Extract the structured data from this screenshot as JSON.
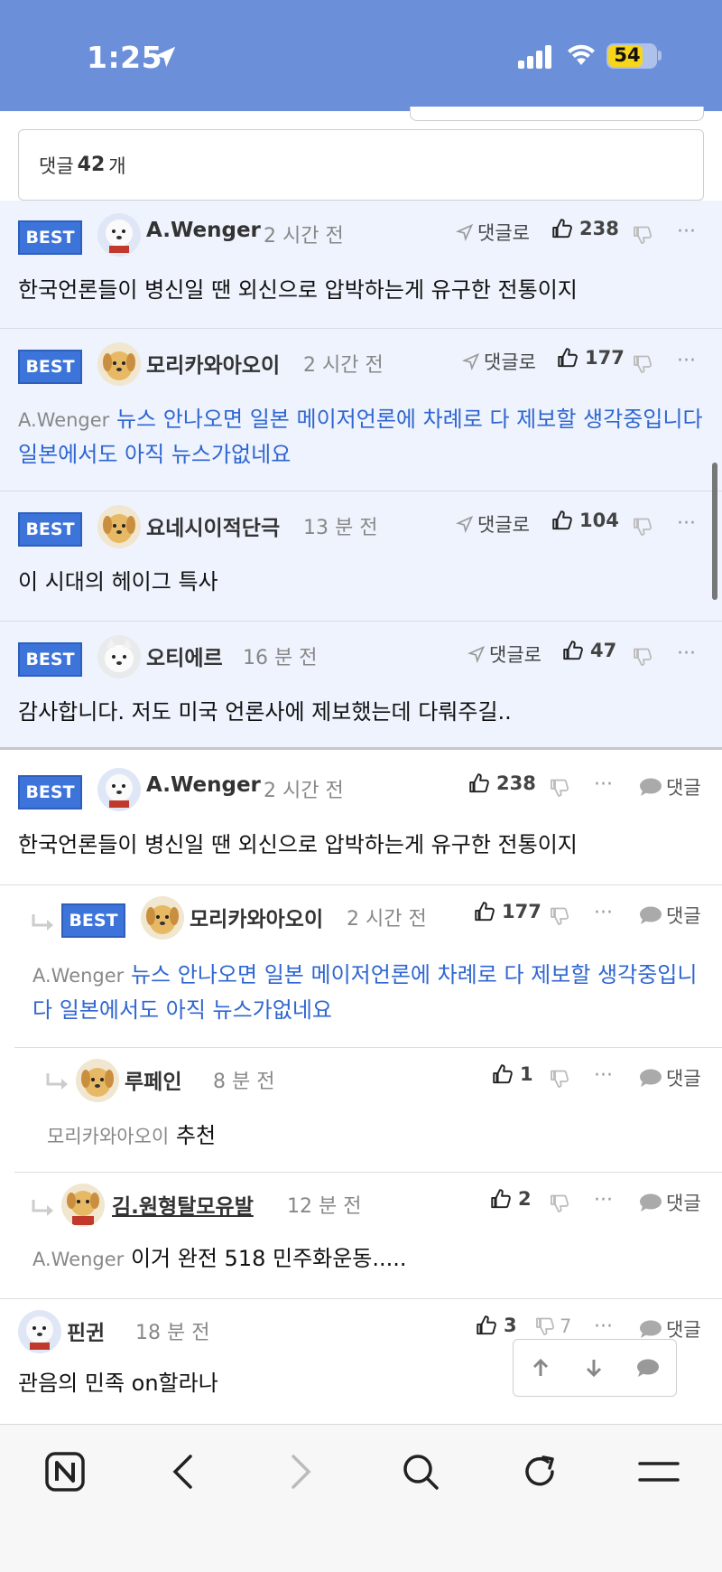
{
  "status_bar": {
    "time": "1:25",
    "battery": "54"
  },
  "comment_count": {
    "prefix": "댓글",
    "count": "42",
    "suffix": "개"
  },
  "labels": {
    "best": "BEST",
    "reply_to": "댓글로",
    "reply": "댓글"
  },
  "best_comments": [
    {
      "nick": "A.Wenger",
      "time": "2 시간 전",
      "likes": "238",
      "text": "한국언론들이 병신일 땐 외신으로 압박하는게 유구한 전통이지"
    },
    {
      "nick": "모리카와아오이",
      "time": "2 시간 전",
      "likes": "177",
      "mention": "A.Wenger",
      "text": "뉴스 안나오면 일본 메이저언론에 차례로 다 제보할 생각중입니다 일본에서도 아직 뉴스가없네요"
    },
    {
      "nick": "요네시이적단극",
      "time": "13 분 전",
      "likes": "104",
      "text": "이 시대의 헤이그 특사"
    },
    {
      "nick": "오티에르",
      "time": "16 분 전",
      "likes": "47",
      "text": "감사합니다. 저도 미국 언론사에 제보했는데 다뤄주길.."
    }
  ],
  "thread": [
    {
      "nick": "A.Wenger",
      "time": "2 시간 전",
      "likes": "238",
      "best": true,
      "text": "한국언론들이 병신일 땐 외신으로 압박하는게 유구한 전통이지"
    },
    {
      "nick": "모리카와아오이",
      "time": "2 시간 전",
      "likes": "177",
      "best": true,
      "mention": "A.Wenger",
      "text": "뉴스 안나오면 일본 메이저언론에 차례로 다 제보할 생각중입니다 일본에서도 아직 뉴스가없네요"
    },
    {
      "nick": "루페인",
      "time": "8 분 전",
      "likes": "1",
      "mention": "모리카와아오이",
      "text": "추천"
    },
    {
      "nick": "김.원형탈모유발",
      "time": "12 분 전",
      "likes": "2",
      "mention": "A.Wenger",
      "text": "이거 완전 518 민주화운동....."
    },
    {
      "nick": "핀귄",
      "time": "18 분 전",
      "likes": "3",
      "dislikes": "7",
      "text": "관음의 민족 on할라나"
    }
  ],
  "toolbar": [
    "naver-home-icon",
    "back-icon",
    "forward-icon",
    "search-icon",
    "reload-icon",
    "menu-icon"
  ]
}
